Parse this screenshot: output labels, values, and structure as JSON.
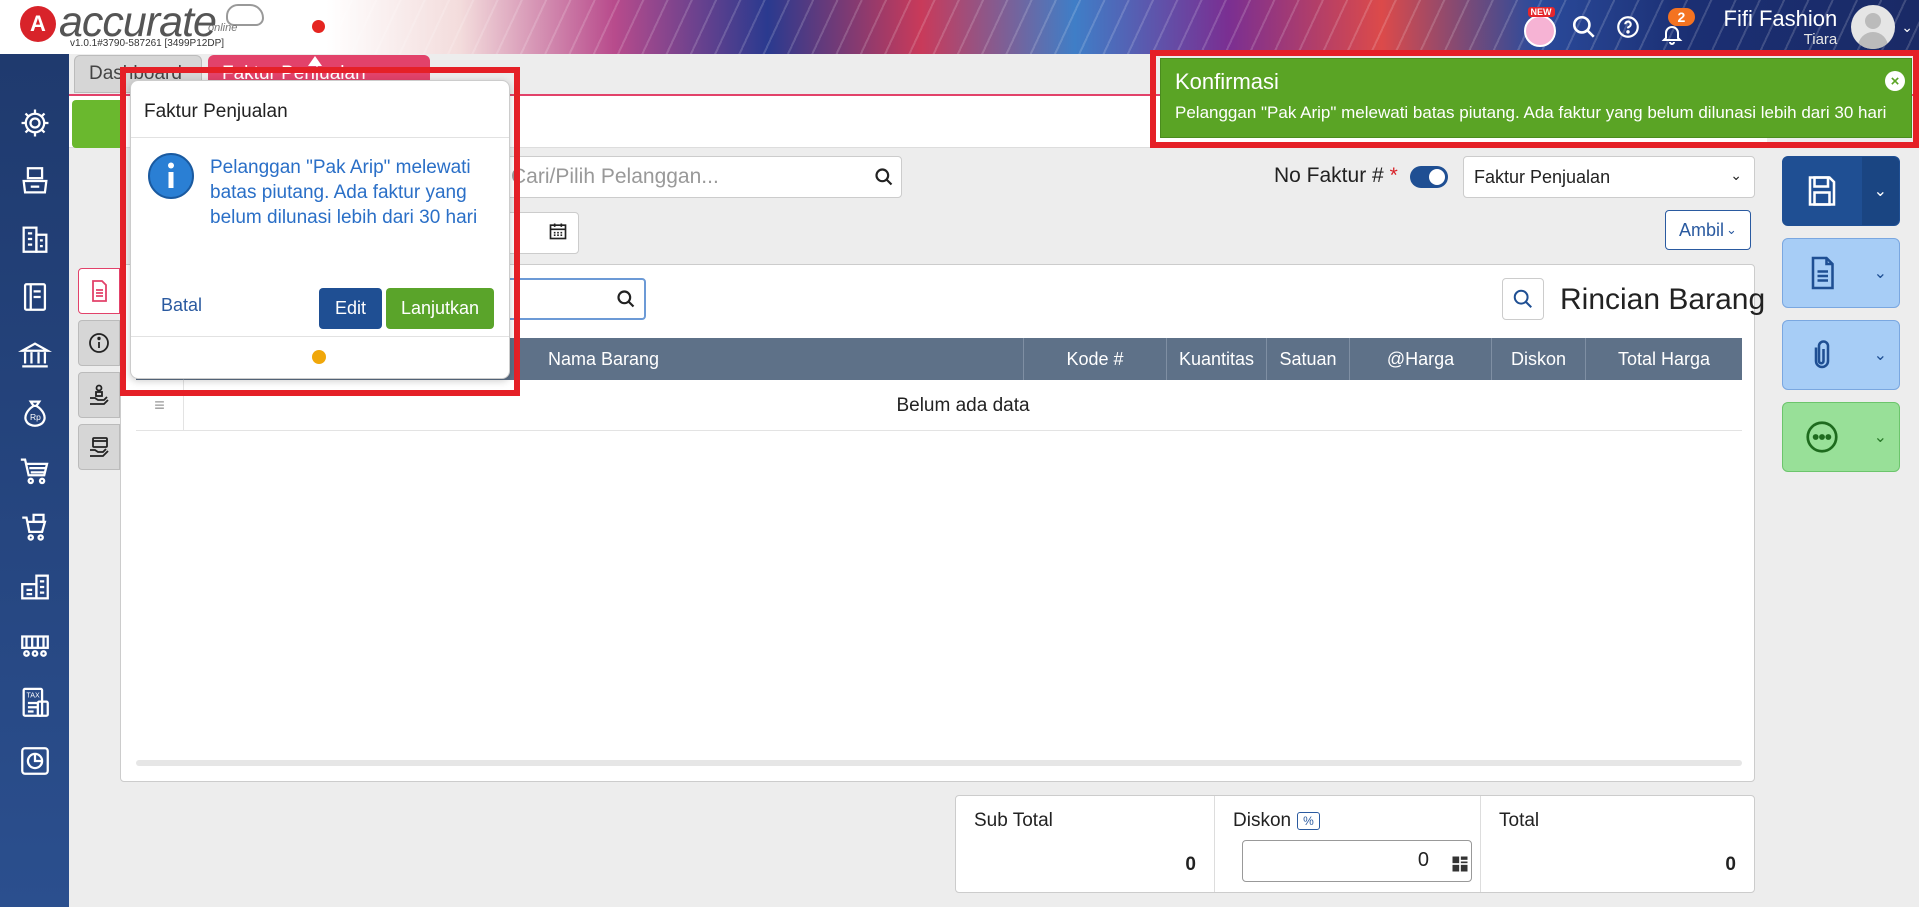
{
  "app": {
    "logo_mark": "A",
    "logo_text": "accurate",
    "logo_sub": "online",
    "version": "v1.0.1#3790-587261 [3499P12DP]"
  },
  "header": {
    "new_badge": "NEW",
    "notification_count": "2",
    "user_name": "Fifi Fashion",
    "user_role": "Tiara"
  },
  "sidebar": {
    "icons": [
      "gear-icon",
      "inventory-icon",
      "building-icon",
      "ledger-icon",
      "bank-icon",
      "money-bag-icon",
      "cart-icon",
      "shopping-list-icon",
      "warehouse-icon",
      "production-icon",
      "tax-icon",
      "report-chart-icon"
    ]
  },
  "tabs": {
    "dashboard": "Dashboard",
    "faktur": "Faktur Penjualan"
  },
  "form": {
    "customer_placeholder": "Cari/Pilih Pelanggan...",
    "no_faktur_label": "No Faktur #",
    "required_mark": "*",
    "type_selected": "Faktur Penjualan",
    "ambil_label": "Ambil"
  },
  "detail": {
    "title": "Rincian Barang",
    "columns": [
      "Nama Barang",
      "Kode #",
      "Kuantitas",
      "Satuan",
      "@Harga",
      "Diskon",
      "Total Harga"
    ],
    "row_handle": "≡",
    "empty_text": "Belum ada data"
  },
  "totals": {
    "subtotal_label": "Sub Total",
    "subtotal_value": "0",
    "diskon_label": "Diskon",
    "diskon_pct": "%",
    "diskon_value": "0",
    "total_label": "Total",
    "total_value": "0"
  },
  "popup": {
    "title": "Faktur Penjualan",
    "message": "Pelanggan \"Pak Arip\" melewati batas piutang. Ada faktur yang belum dilunasi lebih dari 30 hari",
    "cancel": "Batal",
    "edit": "Edit",
    "continue": "Lanjutkan"
  },
  "confirmation": {
    "title": "Konfirmasi",
    "message": "Pelanggan \"Pak Arip\" melewati batas piutang. Ada faktur yang belum dilunasi lebih dari 30 hari",
    "close": "×"
  },
  "colors": {
    "sidebar": "#1f3a6e",
    "tab_active": "#e2426a",
    "primary": "#1f4f93",
    "success": "#5aa425",
    "highlight_frame": "#e52027",
    "dot": "#f0a70a"
  }
}
